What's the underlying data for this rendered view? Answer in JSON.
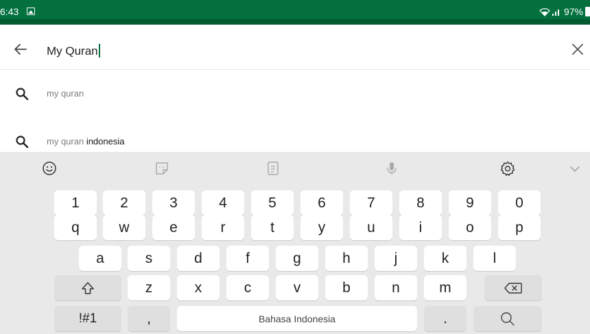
{
  "status_bar": {
    "time": "6:43",
    "battery": "97%",
    "bg_color": "#03703e",
    "icons": [
      "image-icon",
      "wifi-icon",
      "signal-icon",
      "battery-icon"
    ]
  },
  "search": {
    "query": "My Quran",
    "back_icon": "arrow-left-icon",
    "clear_icon": "close-icon",
    "caret_color": "#03703e"
  },
  "suggestions": [
    {
      "prefix": "my quran",
      "bold": ""
    },
    {
      "prefix": "my quran",
      "bold": " indonesia"
    }
  ],
  "keyboard": {
    "toolbar_icons": [
      "emoji-icon",
      "sticker-icon",
      "clipboard-icon",
      "microphone-icon",
      "settings-gear-icon",
      "chevron-down-icon"
    ],
    "number_row": [
      "1",
      "2",
      "3",
      "4",
      "5",
      "6",
      "7",
      "8",
      "9",
      "0"
    ],
    "row1": [
      "q",
      "w",
      "e",
      "r",
      "t",
      "y",
      "u",
      "i",
      "o",
      "p"
    ],
    "row2": [
      "a",
      "s",
      "d",
      "f",
      "g",
      "h",
      "j",
      "k",
      "l"
    ],
    "row3": [
      "z",
      "x",
      "c",
      "v",
      "b",
      "n",
      "m"
    ],
    "symbols_label": "!#1",
    "comma_label": ",",
    "space_label": "Bahasa Indonesia",
    "period_label": "."
  }
}
